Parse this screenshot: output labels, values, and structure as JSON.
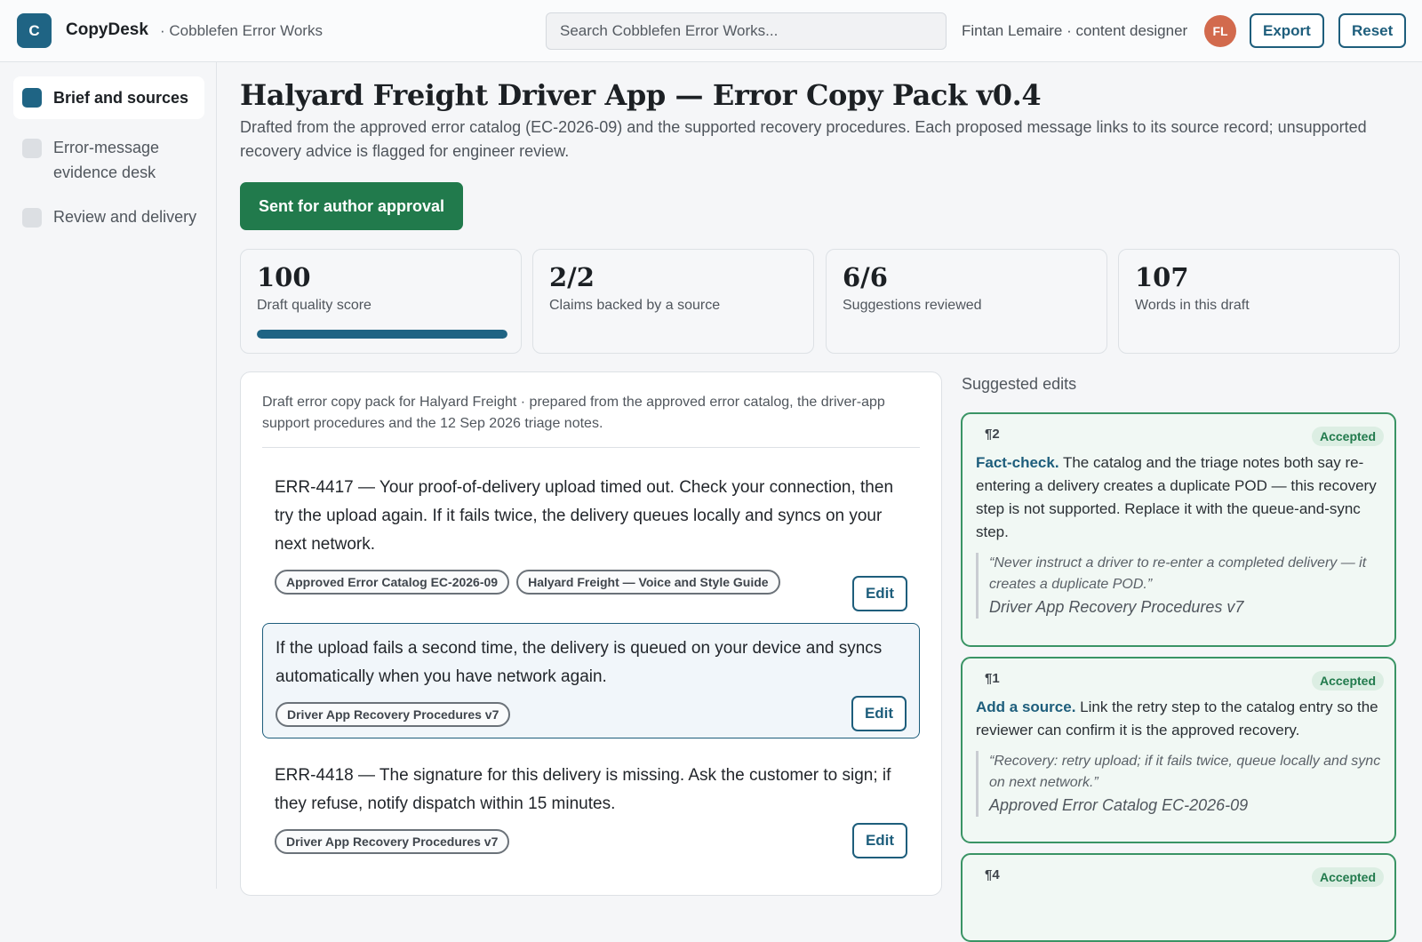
{
  "app": {
    "logo_letter": "C",
    "name": "CopyDesk",
    "workspace": "· Cobblefen Error Works"
  },
  "search": {
    "placeholder": "Search Cobblefen Error Works..."
  },
  "user": {
    "meta": "Fintan Lemaire · content designer",
    "initials": "FL"
  },
  "toolbar": {
    "export_label": "Export",
    "reset_label": "Reset"
  },
  "sidebar": {
    "items": [
      {
        "label": "Brief and sources",
        "active": true
      },
      {
        "label": "Error-message evidence desk",
        "active": false
      },
      {
        "label": "Review and delivery",
        "active": false
      }
    ]
  },
  "page": {
    "title": "Halyard Freight Driver App — Error Copy Pack v0.4",
    "description": "Drafted from the approved error catalog (EC-2026-09) and the supported recovery procedures. Each proposed message links to its source record; unsupported recovery advice is flagged for engineer review.",
    "status_button": "Sent for author approval"
  },
  "stats": [
    {
      "value": "100",
      "label": "Draft quality score",
      "progress": 1.0
    },
    {
      "value": "2/2",
      "label": "Claims backed by a source"
    },
    {
      "value": "6/6",
      "label": "Suggestions reviewed"
    },
    {
      "value": "107",
      "label": "Words in this draft"
    }
  ],
  "doc": {
    "header": "Draft error copy pack for Halyard Freight · prepared from the approved error catalog, the driver-app support procedures and the 12 Sep 2026 triage notes.",
    "edit_label": "Edit",
    "paragraphs": [
      {
        "text": "ERR-4417 — Your proof-of-delivery upload timed out. Check your connection, then try the upload again. If it fails twice, the delivery queues locally and syncs on your next network.",
        "sources": [
          "Approved Error Catalog EC-2026-09",
          "Halyard Freight — Voice and Style Guide"
        ]
      },
      {
        "text": "If the upload fails a second time, the delivery is queued on your device and syncs automatically when you have network again.",
        "sources": [
          "Driver App Recovery Procedures v7"
        ]
      },
      {
        "text": "ERR-4418 — The signature for this delivery is missing. Ask the customer to sign; if they refuse, notify dispatch within 15 minutes.",
        "sources": [
          "Driver App Recovery Procedures v7"
        ]
      }
    ]
  },
  "suggestions": {
    "heading": "Suggested edits",
    "items": [
      {
        "para": "¶2",
        "status": "Accepted",
        "kind": "Fact-check.",
        "body": "The catalog and the triage notes both say re-entering a delivery creates a duplicate POD — this recovery step is not supported. Replace it with the queue-and-sync step.",
        "quote": "“Never instruct a driver to re-enter a completed delivery — it creates a duplicate POD.”",
        "source": "Driver App Recovery Procedures v7"
      },
      {
        "para": "¶1",
        "status": "Accepted",
        "kind": "Add a source.",
        "body": "Link the retry step to the catalog entry so the reviewer can confirm it is the approved recovery.",
        "quote": "“Recovery: retry upload; if it fails twice, queue locally and sync on next network.”",
        "source": "Approved Error Catalog EC-2026-09"
      },
      {
        "para": "¶4",
        "status": "Accepted"
      }
    ]
  },
  "colors": {
    "brand": "#1f6484",
    "approve": "#217a4c",
    "accepted_border": "#3a9465",
    "avatar": "#d26a4d"
  },
  "icons": {
    "logo": "copydesk-logo-icon",
    "nav_check": "checkbox-icon"
  }
}
